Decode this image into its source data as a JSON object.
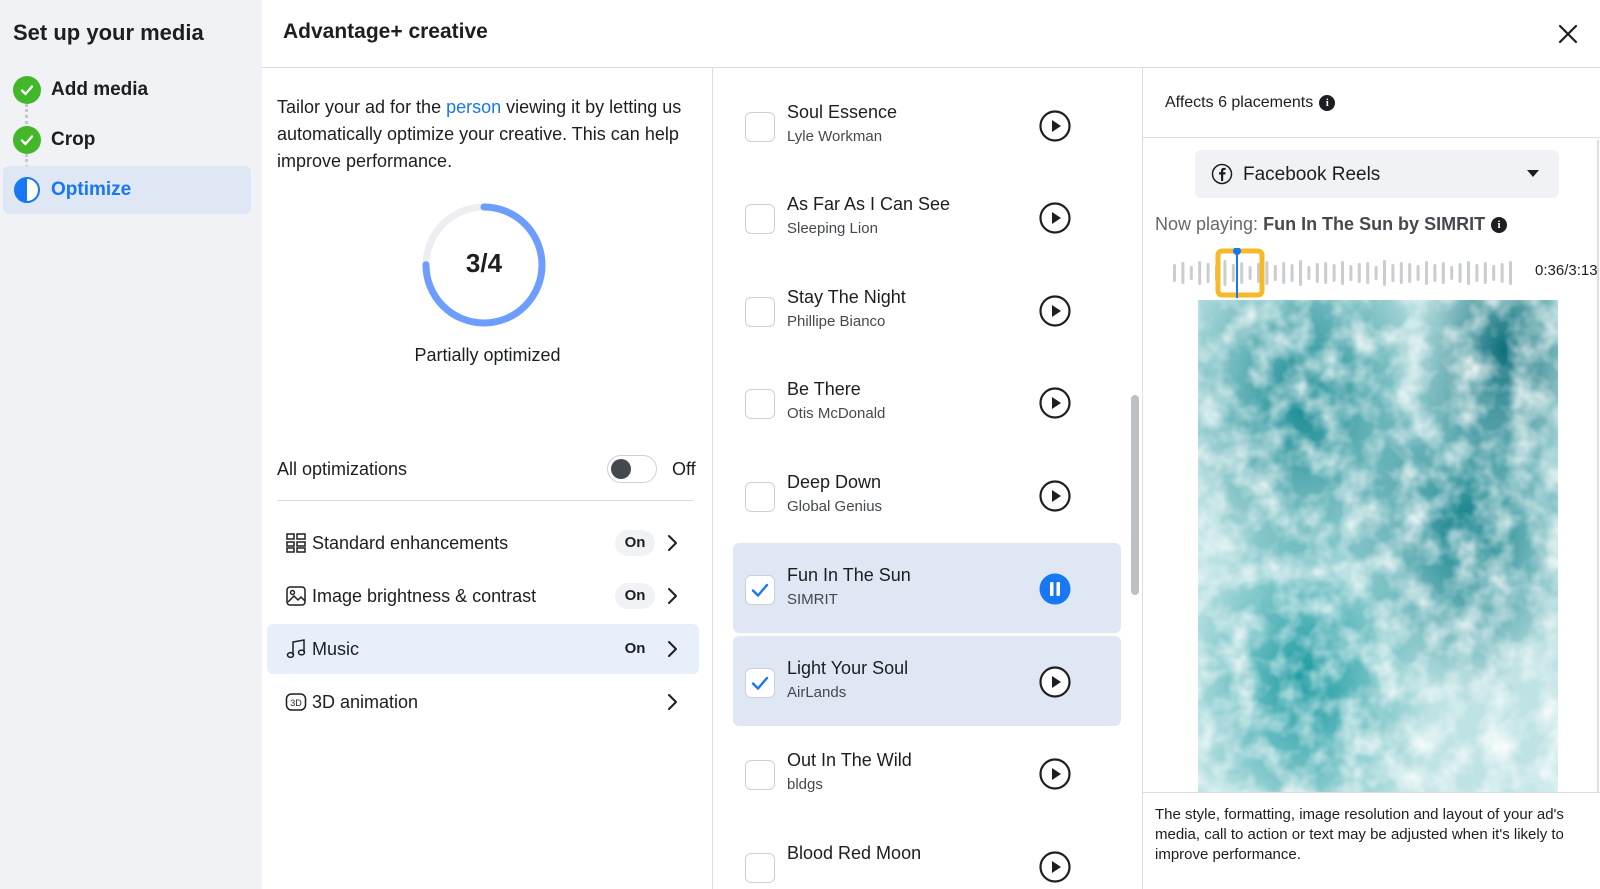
{
  "sidebar": {
    "title": "Set up your media",
    "steps": [
      {
        "label": "Add media",
        "status": "complete"
      },
      {
        "label": "Crop",
        "status": "complete"
      },
      {
        "label": "Optimize",
        "status": "in-progress"
      }
    ]
  },
  "header": {
    "title": "Advantage+ creative",
    "close_icon": "close-icon"
  },
  "optimization": {
    "description_before": "Tailor your ad for the ",
    "description_link": "person",
    "description_after": " viewing it by letting us automatically optimize your creative. This can help improve performance.",
    "progress_text": "3/4",
    "progress_fraction": 0.75,
    "progress_caption": "Partially optimized",
    "all_optimizations_label": "All optimizations",
    "all_optimizations_state": "Off",
    "items": [
      {
        "label": "Standard enhancements",
        "badge": "On",
        "icon": "grid-icon"
      },
      {
        "label": "Image brightness & contrast",
        "badge": "On",
        "icon": "image-icon"
      },
      {
        "label": "Music",
        "badge": "On",
        "icon": "music-note-icon"
      },
      {
        "label": "3D animation",
        "badge": "",
        "icon": "3d-icon"
      }
    ]
  },
  "music": {
    "tracks": [
      {
        "title": "Soul Essence",
        "artist": "Lyle Workman",
        "checked": false,
        "playing": false
      },
      {
        "title": "As Far As I Can See",
        "artist": "Sleeping Lion",
        "checked": false,
        "playing": false
      },
      {
        "title": "Stay The Night",
        "artist": "Phillipe Bianco",
        "checked": false,
        "playing": false
      },
      {
        "title": "Be There",
        "artist": "Otis McDonald",
        "checked": false,
        "playing": false
      },
      {
        "title": "Deep Down",
        "artist": "Global Genius",
        "checked": false,
        "playing": false
      },
      {
        "title": "Fun In The Sun",
        "artist": "SIMRIT",
        "checked": true,
        "playing": true
      },
      {
        "title": "Light Your Soul",
        "artist": "AirLands",
        "checked": true,
        "playing": false
      },
      {
        "title": "Out In The Wild",
        "artist": "bldgs",
        "checked": false,
        "playing": false
      },
      {
        "title": "Blood Red Moon",
        "artist": "",
        "checked": false,
        "playing": false
      }
    ]
  },
  "preview": {
    "placements_text": "Affects 6 placements",
    "placement_selected": "Facebook Reels",
    "now_playing_label": "Now playing:",
    "now_playing_track": "Fun In The Sun by SIMRIT",
    "time": "0:36/3:13",
    "note": "The style, formatting, image resolution and layout of your ad's media, call to action or text may be adjusted when it's likely to improve performance.",
    "colors": {
      "accent": "#1877f2",
      "wave_highlight": "#f7b928",
      "water_dark": "#1b8a92",
      "water_light": "#e8f6f6"
    }
  }
}
